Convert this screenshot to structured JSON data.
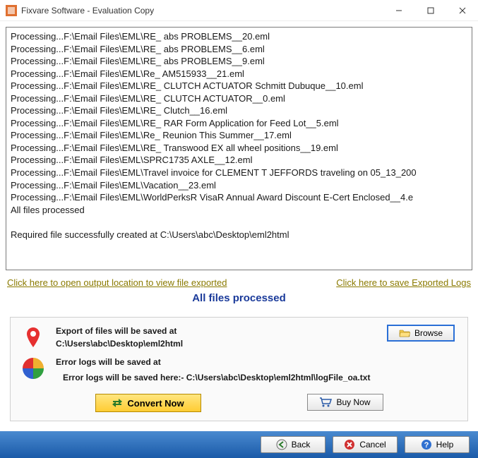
{
  "window": {
    "title": "Fixvare Software - Evaluation Copy"
  },
  "log": {
    "lines": [
      "Processing...F:\\Email Files\\EML\\RE_ abs PROBLEMS__20.eml",
      "Processing...F:\\Email Files\\EML\\RE_ abs PROBLEMS__6.eml",
      "Processing...F:\\Email Files\\EML\\RE_ abs PROBLEMS__9.eml",
      "Processing...F:\\Email Files\\EML\\Re_ AM515933__21.eml",
      "Processing...F:\\Email Files\\EML\\RE_ CLUTCH ACTUATOR Schmitt Dubuque__10.eml",
      "Processing...F:\\Email Files\\EML\\RE_ CLUTCH ACTUATOR__0.eml",
      "Processing...F:\\Email Files\\EML\\RE_ Clutch__16.eml",
      "Processing...F:\\Email Files\\EML\\RE_ RAR Form Application for Feed Lot__5.eml",
      "Processing...F:\\Email Files\\EML\\Re_ Reunion This Summer__17.eml",
      "Processing...F:\\Email Files\\EML\\RE_ Transwood EX all wheel positions__19.eml",
      "Processing...F:\\Email Files\\EML\\SPRC1735 AXLE__12.eml",
      "Processing...F:\\Email Files\\EML\\Travel invoice for CLEMENT T JEFFORDS traveling on 05_13_200",
      "Processing...F:\\Email Files\\EML\\Vacation__23.eml",
      "Processing...F:\\Email Files\\EML\\WorldPerksR VisaR Annual Award Discount E-Cert Enclosed__4.e",
      "All files processed",
      "",
      "Required file successfully created at C:\\Users\\abc\\Desktop\\eml2html"
    ]
  },
  "links": {
    "open_output": "Click here to open output location to view file exported",
    "save_logs": "Click here to save Exported Logs"
  },
  "status": "All files processed",
  "export": {
    "label": "Export of files will be saved at",
    "path": "C:\\Users\\abc\\Desktop\\eml2html",
    "browse": "Browse"
  },
  "errors": {
    "label": "Error logs will be saved at",
    "path": "Error logs will be saved here:- C:\\Users\\abc\\Desktop\\eml2html\\logFile_oa.txt"
  },
  "actions": {
    "convert": "Convert Now",
    "buy": "Buy Now"
  },
  "footer": {
    "back": "Back",
    "cancel": "Cancel",
    "help": "Help"
  }
}
